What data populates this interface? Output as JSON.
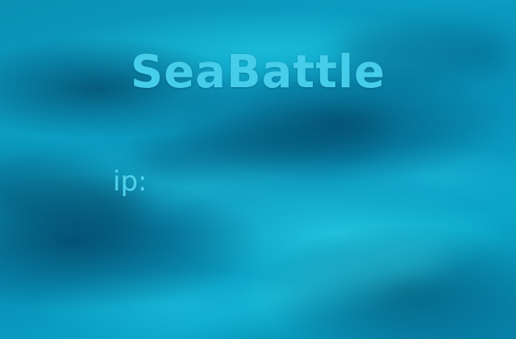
{
  "screen": {
    "title": "SeaBattle",
    "ip_label": "ip:",
    "ip_value": ""
  }
}
